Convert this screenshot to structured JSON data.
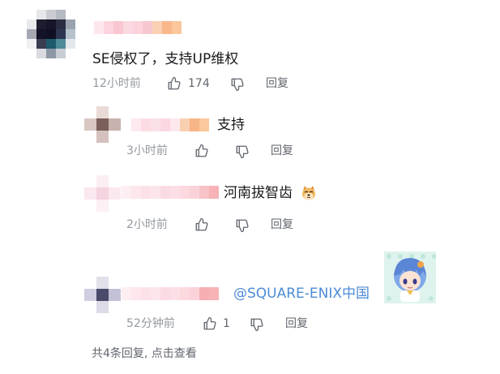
{
  "comment": {
    "text": "SE侵权了，支持UP维权",
    "time": "12小时前",
    "like_count": "174",
    "reply_label": "回复"
  },
  "replies": [
    {
      "text": "支持",
      "time": "3小时前",
      "like_count": "",
      "reply_label": "回复"
    },
    {
      "text": "河南拔智齿",
      "emoji": "doge-emoji",
      "time": "2小时前",
      "like_count": "",
      "reply_label": "回复"
    },
    {
      "text": "@SQUARE-ENIX中国",
      "time": "52分钟前",
      "like_count": "1",
      "reply_label": "回复"
    }
  ],
  "footer": {
    "text": "共4条回复, 点击查看"
  },
  "icons": [
    "thumb-up-icon",
    "thumb-down-icon",
    "doge-emoji",
    "anime-sticker"
  ],
  "colors": {
    "meta": "#9499a0",
    "mention": "#4c8bd6",
    "text": "#18191c"
  }
}
